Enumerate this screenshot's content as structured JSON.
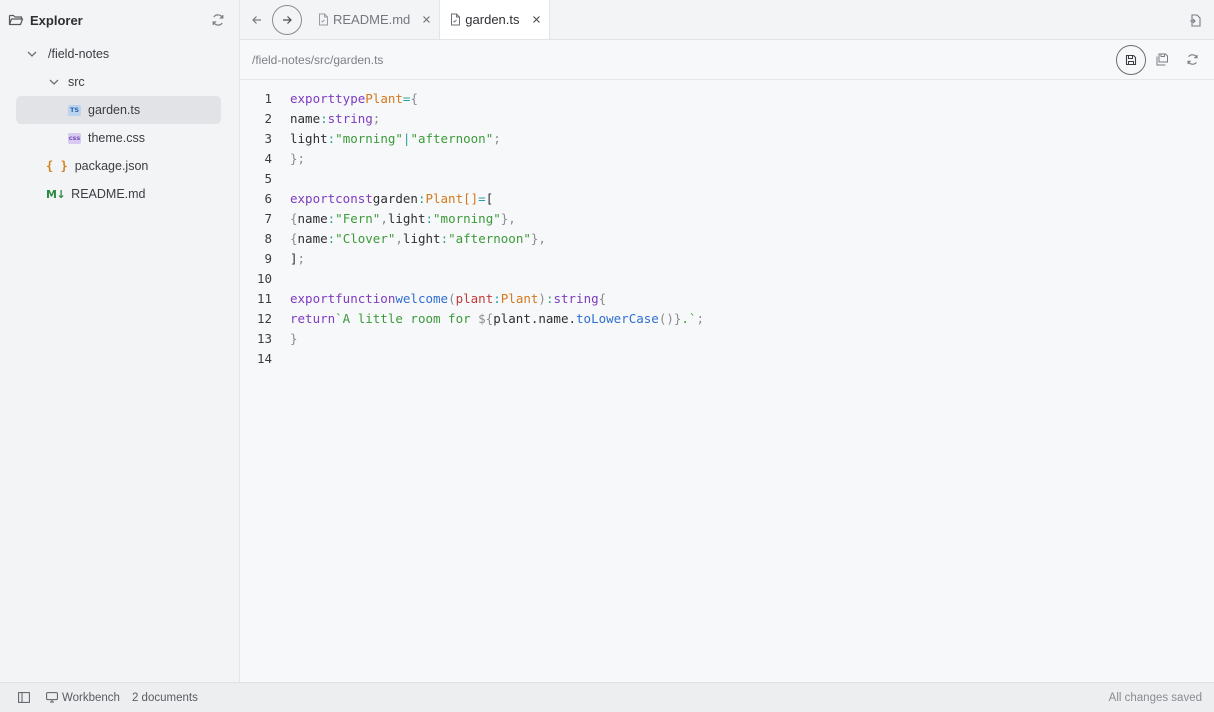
{
  "sidebar": {
    "title": "Explorer",
    "root": "/field-notes",
    "folder": "src",
    "files": {
      "garden": "garden.ts",
      "theme": "theme.css",
      "package": "package.json",
      "readme": "README.md"
    },
    "badges": {
      "ts": "TS",
      "css": "css",
      "braces": "{ }",
      "md": "M↓"
    }
  },
  "tabs": [
    {
      "label": "README.md",
      "active": false
    },
    {
      "label": "garden.ts",
      "active": true
    }
  ],
  "editor": {
    "path": "/field-notes/src/garden.ts",
    "line_numbers": [
      "1",
      "2",
      "3",
      "4",
      "5",
      "6",
      "7",
      "8",
      "9",
      "10",
      "11",
      "12",
      "13",
      "14"
    ]
  },
  "status": {
    "workspace": "Workbench",
    "documents": "2 documents",
    "saved": "All changes saved"
  },
  "icons": {
    "explorer": "folder-open-icon",
    "refresh": "refresh-icon",
    "back": "arrow-left-icon",
    "forward": "arrow-right-icon",
    "file": "file-icon",
    "close": "close-icon",
    "save": "save-icon",
    "save_all": "save-all-icon",
    "reload": "reload-icon",
    "open_file": "open-file-icon",
    "sidebar_toggle": "sidebar-toggle-icon",
    "monitor": "monitor-icon"
  },
  "colors": {
    "keyword": "#7d3cc0",
    "type": "#d4781c",
    "string": "#3d9a3b",
    "function": "#2f6fd1",
    "param": "#c23a3a",
    "selection": "#e2e3e7"
  }
}
